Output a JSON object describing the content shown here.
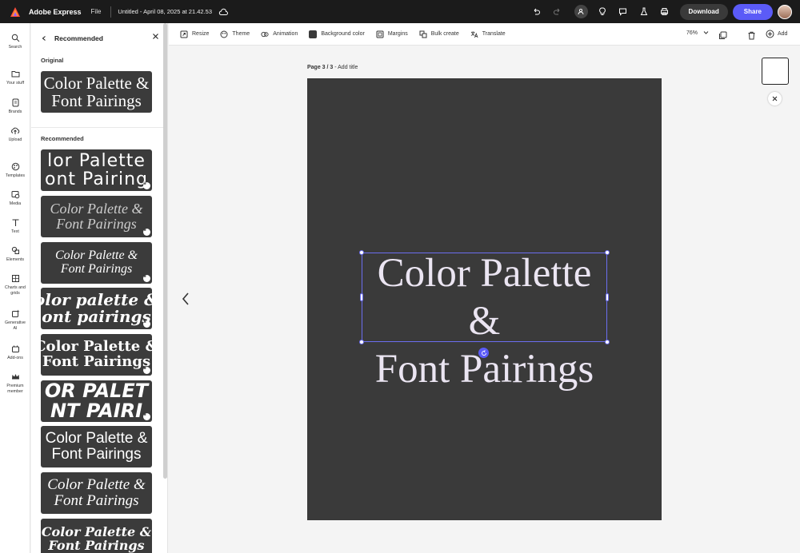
{
  "topbar": {
    "app_name": "Adobe Express",
    "file_menu": "File",
    "doc_title": "Untitled - April 08, 2025 at 21.42.53",
    "download_label": "Download",
    "share_label": "Share"
  },
  "rail": {
    "items": [
      {
        "label": "Search",
        "icon": "search-icon"
      },
      {
        "label": "Your stuff",
        "icon": "folder-icon"
      },
      {
        "label": "Brands",
        "icon": "brand-icon"
      },
      {
        "label": "Upload",
        "icon": "upload-icon"
      },
      {
        "label": "Templates",
        "icon": "templates-icon"
      },
      {
        "label": "Media",
        "icon": "media-icon"
      },
      {
        "label": "Text",
        "icon": "text-icon"
      },
      {
        "label": "Elements",
        "icon": "elements-icon"
      },
      {
        "label": "Charts and grids",
        "icon": "charts-icon"
      },
      {
        "label": "Generative AI",
        "icon": "generative-ai-icon"
      },
      {
        "label": "Add-ons",
        "icon": "add-ons-icon"
      },
      {
        "label": "Premium member",
        "icon": "crown-icon"
      }
    ]
  },
  "panel": {
    "title": "Recommended",
    "original_label": "Original",
    "recommended_label": "Recommended",
    "card_line1": "Color Palette &",
    "card_line2": "Font Pairings",
    "variants": [
      {
        "line1": "lor Palette",
        "line2": "ont Pairing"
      },
      {
        "line1": "Color Palette &",
        "line2": "Font Pairings"
      },
      {
        "line1": "Color Palette &",
        "line2": "Font Pairings"
      },
      {
        "line1": "olor palette &",
        "line2": "ont pairings"
      },
      {
        "line1": "Color Palette &",
        "line2": "Font Pairings"
      },
      {
        "line1": "OR PALET",
        "line2": "NT PAIRI"
      },
      {
        "line1": "Color Palette &",
        "line2": "Font Pairings"
      },
      {
        "line1": "Color Palette &",
        "line2": "Font Pairings"
      },
      {
        "line1": "Color Palette &",
        "line2": "Font Pairings"
      }
    ]
  },
  "toolbar": {
    "resize": "Resize",
    "theme": "Theme",
    "animation": "Animation",
    "background_color": "Background color",
    "margins": "Margins",
    "bulk_create": "Bulk create",
    "translate": "Translate",
    "zoom": "76%",
    "add": "Add"
  },
  "canvas": {
    "page_number": "Page 3 / 3",
    "add_title": "- Add title",
    "text_line1": "Color Palette &",
    "text_line2": "Font Pairings",
    "background": "#3a3a3a"
  },
  "colors": {
    "accent": "#5b5bf7",
    "topbar": "#1b1b1b"
  }
}
